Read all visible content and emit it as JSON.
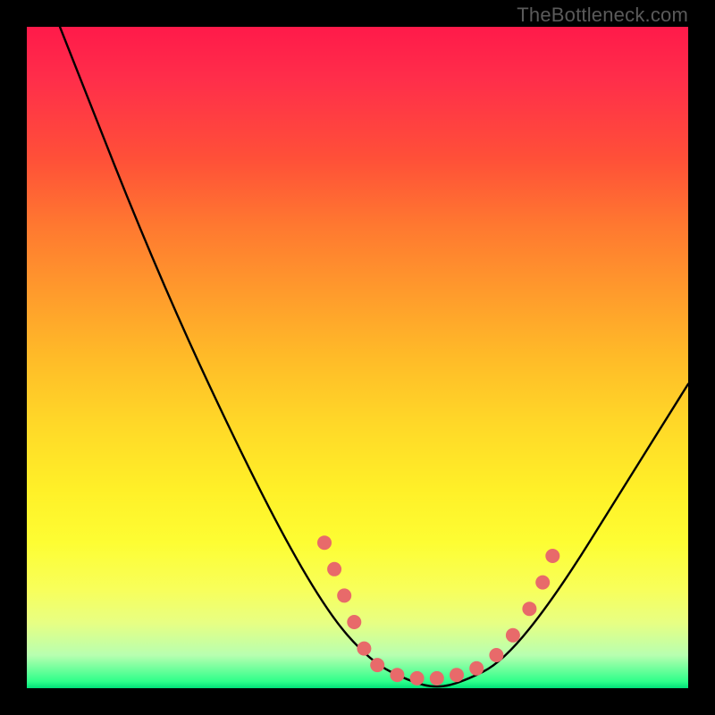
{
  "watermark": {
    "text": "TheBottleneck.com"
  },
  "chart_data": {
    "type": "line",
    "title": "",
    "xlabel": "",
    "ylabel": "",
    "xlim": [
      0,
      100
    ],
    "ylim": [
      0,
      100
    ],
    "curve": {
      "name": "bottleneck-curve",
      "points": [
        {
          "x": 5,
          "y": 100
        },
        {
          "x": 20,
          "y": 62
        },
        {
          "x": 35,
          "y": 30
        },
        {
          "x": 45,
          "y": 12
        },
        {
          "x": 52,
          "y": 4
        },
        {
          "x": 58,
          "y": 1
        },
        {
          "x": 62,
          "y": 0
        },
        {
          "x": 66,
          "y": 1
        },
        {
          "x": 72,
          "y": 4
        },
        {
          "x": 80,
          "y": 14
        },
        {
          "x": 90,
          "y": 30
        },
        {
          "x": 100,
          "y": 46
        }
      ]
    },
    "markers": {
      "name": "highlighted-range-dots",
      "color": "#e86a6a",
      "radius": 8,
      "points": [
        {
          "x": 45,
          "y": 22
        },
        {
          "x": 46.5,
          "y": 18
        },
        {
          "x": 48,
          "y": 14
        },
        {
          "x": 49.5,
          "y": 10
        },
        {
          "x": 51,
          "y": 6
        },
        {
          "x": 53,
          "y": 3.5
        },
        {
          "x": 56,
          "y": 2
        },
        {
          "x": 59,
          "y": 1.5
        },
        {
          "x": 62,
          "y": 1.5
        },
        {
          "x": 65,
          "y": 2
        },
        {
          "x": 68,
          "y": 3
        },
        {
          "x": 71,
          "y": 5
        },
        {
          "x": 73.5,
          "y": 8
        },
        {
          "x": 76,
          "y": 12
        },
        {
          "x": 78,
          "y": 16
        },
        {
          "x": 79.5,
          "y": 20
        }
      ]
    },
    "gradient_stops": [
      {
        "pos": 0,
        "color": "#ff1a4a"
      },
      {
        "pos": 50,
        "color": "#ffd828"
      },
      {
        "pos": 85,
        "color": "#f8ff5a"
      },
      {
        "pos": 100,
        "color": "#00e078"
      }
    ]
  }
}
